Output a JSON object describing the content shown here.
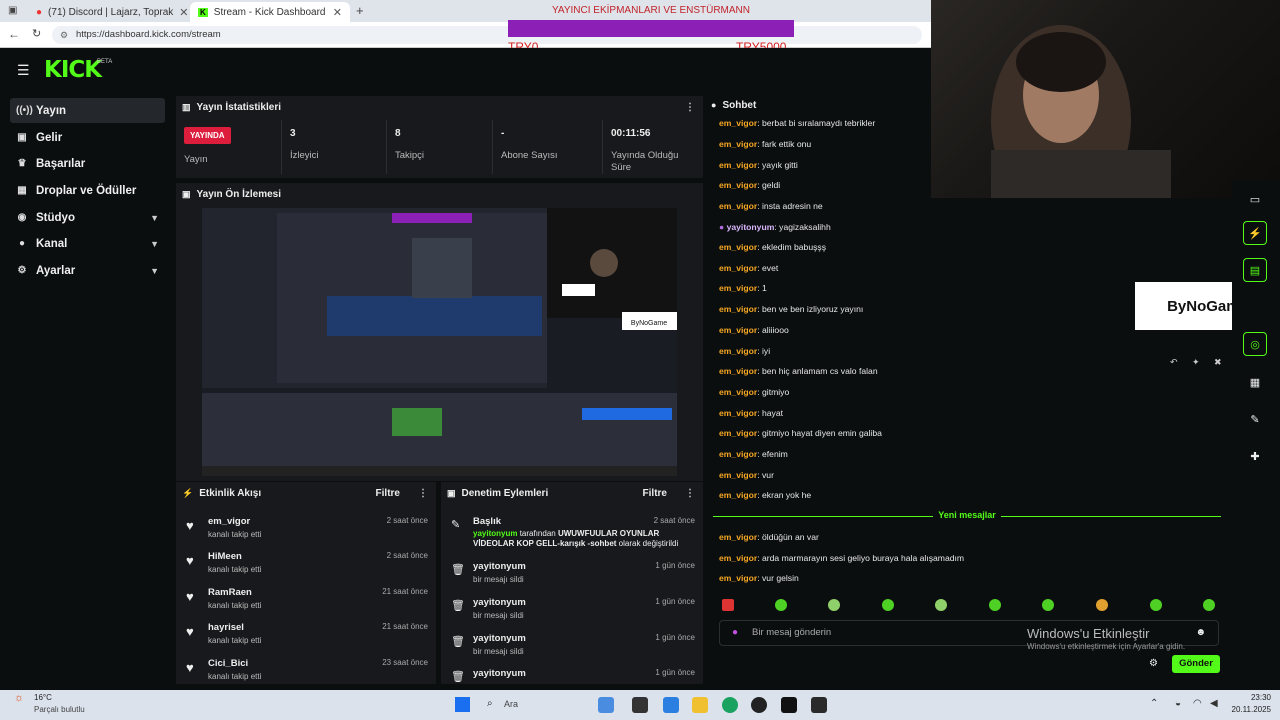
{
  "browser": {
    "tabs": [
      {
        "label": "(71) Discord | Lajarz, Toprak"
      },
      {
        "label": "Stream - Kick Dashboard"
      }
    ],
    "url": "https://dashboard.kick.com/stream"
  },
  "overlay": {
    "goal_title": "YAYINCI EKİPMANLARI VE ENSTÜRMANN",
    "goal_min": "TRY0",
    "goal_max": "TRY5000"
  },
  "brand": {
    "logo": "KICK",
    "beta": "BETA",
    "accent": "#53fc18"
  },
  "sidebar": {
    "items": [
      {
        "label": "Yayın",
        "icon": "broadcast-icon"
      },
      {
        "label": "Gelir",
        "icon": "money-icon"
      },
      {
        "label": "Başarılar",
        "icon": "trophy-icon"
      },
      {
        "label": "Droplar ve Ödüller",
        "icon": "gift-icon"
      },
      {
        "label": "Stüdyo",
        "icon": "studio-icon"
      },
      {
        "label": "Kanal",
        "icon": "person-icon"
      },
      {
        "label": "Ayarlar",
        "icon": "gear-icon"
      }
    ]
  },
  "stats": {
    "title": "Yayın İstatistikleri",
    "live_badge": "YAYINDA",
    "live_label": "Yayın",
    "viewers_value": "3",
    "viewers_label": "İzleyici",
    "followers_value": "8",
    "followers_label": "Takipçi",
    "subs_value": "-",
    "subs_label": "Abone Sayısı",
    "uptime_value": "00:11:56",
    "uptime_label": "Yayında Olduğu Süre"
  },
  "preview": {
    "title": "Yayın Ön İzlemesi",
    "sponsor": "ByNoGame"
  },
  "activity": {
    "title": "Etkinlik Akışı",
    "filter": "Filtre",
    "items": [
      {
        "name": "em_vigor",
        "sub": "kanalı takip etti",
        "time": "2 saat önce"
      },
      {
        "name": "HiMeen",
        "sub": "kanalı takip etti",
        "time": "2 saat önce"
      },
      {
        "name": "RamRaen",
        "sub": "kanalı takip etti",
        "time": "21 saat önce"
      },
      {
        "name": "hayrisel",
        "sub": "kanalı takip etti",
        "time": "21 saat önce"
      },
      {
        "name": "Cici_Bici",
        "sub": "kanalı takip etti",
        "time": "23 saat önce"
      }
    ]
  },
  "moderation": {
    "title": "Denetim Eylemleri",
    "filter": "Filtre",
    "first": {
      "name": "Başlık",
      "time": "2 saat önce",
      "actor": "yayitonyum",
      "mid": " tarafından ",
      "old_title": "UWUWFUULAR OYUNLAR VİDEOLAR KOP GELL-karışık -sohbet",
      "tail": " olarak değiştirildi"
    },
    "items": [
      {
        "name": "yayitonyum",
        "sub": "bir mesajı sildi",
        "time": "1 gün önce"
      },
      {
        "name": "yayitonyum",
        "sub": "bir mesajı sildi",
        "time": "1 gün önce"
      },
      {
        "name": "yayitonyum",
        "sub": "bir mesajı sildi",
        "time": "1 gün önce"
      },
      {
        "name": "yayitonyum",
        "sub": "",
        "time": "1 gün önce"
      }
    ]
  },
  "chat": {
    "title": "Sohbet",
    "messages": [
      {
        "user": "em_vigor",
        "text": "berbat bi sıralamaydı tebrikler"
      },
      {
        "user": "em_vigor",
        "text": "fark ettik onu"
      },
      {
        "user": "em_vigor",
        "text": "yayık gitti"
      },
      {
        "user": "em_vigor",
        "text": "geldi"
      },
      {
        "user": "em_vigor",
        "text": "insta adresin ne"
      },
      {
        "user": "yayitonyum",
        "text": "yagizaksalihh"
      },
      {
        "user": "em_vigor",
        "text": "ekledim babuşşş"
      },
      {
        "user": "em_vigor",
        "text": "evet"
      },
      {
        "user": "em_vigor",
        "text": "1"
      },
      {
        "user": "em_vigor",
        "text": "ben ve ben izliyoruz yayını"
      },
      {
        "user": "em_vigor",
        "text": "aliiiooo"
      },
      {
        "user": "em_vigor",
        "text": "iyi"
      },
      {
        "user": "em_vigor",
        "text": "ben hiç anlamam cs valo falan"
      },
      {
        "user": "em_vigor",
        "text": "gitmiyo"
      },
      {
        "user": "em_vigor",
        "text": "hayat"
      },
      {
        "user": "em_vigor",
        "text": "gitmiyo hayat diyen emin galiba"
      },
      {
        "user": "em_vigor",
        "text": "efenim"
      },
      {
        "user": "em_vigor",
        "text": "vur"
      },
      {
        "user": "em_vigor",
        "text": "ekran yok he"
      }
    ],
    "new_label": "Yeni mesajlar",
    "new_messages": [
      {
        "user": "em_vigor",
        "text": "öldüğün an var"
      },
      {
        "user": "em_vigor",
        "text": "arda marmarayın sesi geliyo buraya hala alışamadım"
      },
      {
        "user": "em_vigor",
        "text": "vur gelsin"
      }
    ],
    "input_placeholder": "Bir mesaj gönderin",
    "send": "Gönder",
    "sep": ": "
  },
  "sponsor_banner": "ByNoGame",
  "windows_watermark": {
    "line1": "Windows'u Etkinleştir",
    "line2": "Windows'u etkinleştirmek için Ayarlar'a gidin."
  },
  "taskbar": {
    "weather_temp": "16°C",
    "weather_desc": "Parçalı bulutlu",
    "search": "Ara",
    "time": "23:30",
    "date": "20.11.2025"
  }
}
